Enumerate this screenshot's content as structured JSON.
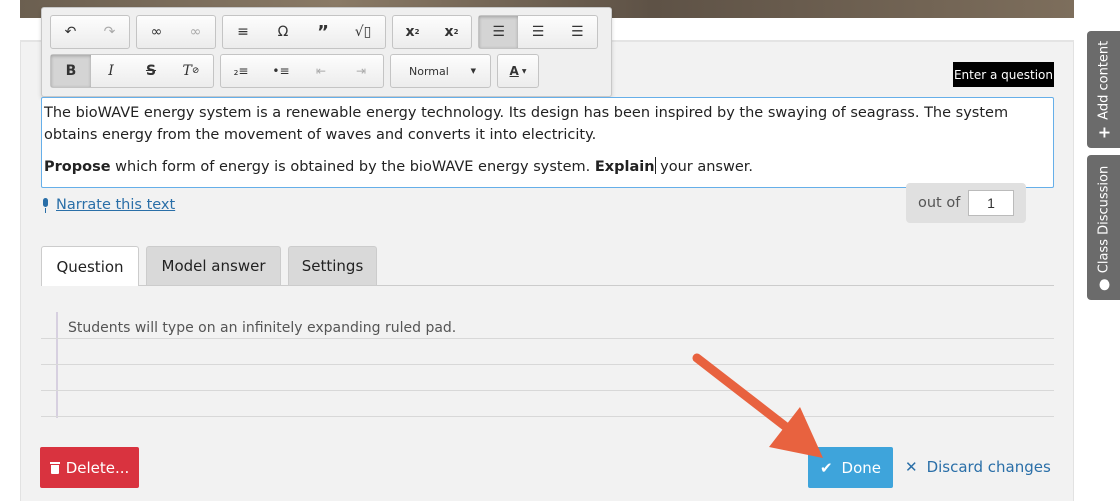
{
  "toolbar": {
    "row1": {
      "history": [
        "undo-icon",
        "redo-icon"
      ],
      "links": [
        "link-icon",
        "unlink-icon"
      ],
      "insert": [
        "horizontal-rule-icon",
        "special-char-icon",
        "blockquote-icon",
        "math-icon"
      ],
      "script": [
        "subscript-icon",
        "superscript-icon"
      ],
      "align": [
        "align-left-icon",
        "align-center-icon",
        "align-right-icon"
      ],
      "active_align": "align-left-icon"
    },
    "row2": {
      "basic": [
        "bold-icon",
        "italic-icon",
        "strikethrough-icon",
        "clear-format-icon"
      ],
      "active_basic": "bold-icon",
      "lists": [
        "numbered-list-icon",
        "bulleted-list-icon",
        "outdent-icon",
        "indent-icon"
      ],
      "format_value": "Normal",
      "text_color": "A"
    }
  },
  "editor": {
    "label": "Enter a question",
    "paragraph1": "The bioWAVE energy system is a renewable energy technology. Its design has been inspired by the swaying of seagrass. The system obtains energy from the movement of waves and converts it into electricity.",
    "p2_bold1": "Propose",
    "p2_mid": " which form of energy is obtained by the bioWAVE energy system. ",
    "p2_bold2": "Explain",
    "p2_end": " your answer."
  },
  "narrate": {
    "label": "Narrate this text"
  },
  "score": {
    "label": "out of",
    "value": "1"
  },
  "tabs": [
    {
      "label": "Question",
      "active": true
    },
    {
      "label": "Model answer",
      "active": false
    },
    {
      "label": "Settings",
      "active": false
    }
  ],
  "pad": {
    "hint": "Students will type on an infinitely expanding ruled pad."
  },
  "actions": {
    "delete_label": "Delete...",
    "done_label": "Done",
    "discard_label": "Discard changes"
  },
  "sidebar": {
    "add_content": "Add content",
    "class_discussion": "Class Discussion"
  },
  "colors": {
    "delete": "#d9333f",
    "done": "#3ea4db",
    "link": "#2a6fa8",
    "arrow": "#e8623f",
    "editor_border": "#66afe9"
  }
}
